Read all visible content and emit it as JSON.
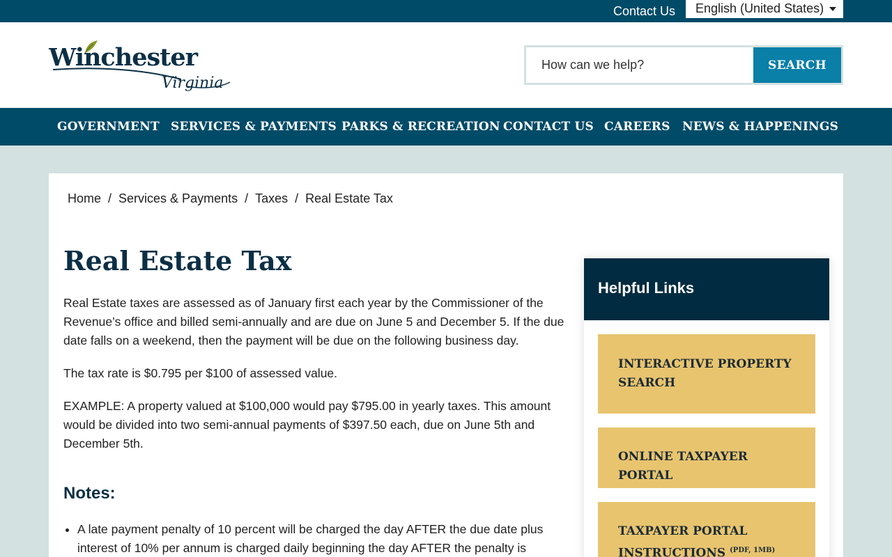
{
  "utility": {
    "contact_label": "Contact Us",
    "language": "English (United States)"
  },
  "logo": {
    "name": "Winchester",
    "script": "Virginia"
  },
  "search": {
    "placeholder": "How can we help?",
    "button_label": "SEARCH"
  },
  "nav": {
    "items": [
      {
        "label": "GOVERNMENT"
      },
      {
        "label": "SERVICES & PAYMENTS"
      },
      {
        "label": "PARKS & RECREATION"
      },
      {
        "label": "CONTACT US"
      },
      {
        "label": "CAREERS"
      },
      {
        "label": "NEWS & HAPPENINGS"
      }
    ]
  },
  "breadcrumb": {
    "items": [
      "Home",
      "Services & Payments",
      "Taxes",
      "Real Estate Tax"
    ],
    "separator": "/"
  },
  "page": {
    "title": "Real Estate Tax",
    "paragraphs": [
      "Real Estate taxes are assessed as of January first each year by the Commissioner of the Revenue’s office and billed semi-annually and are due on June 5 and December 5. If the due date falls on a weekend, then the payment will be due on the following business day.",
      "The tax rate is $0.795 per $100 of assessed value.",
      "EXAMPLE: A property valued at $100,000 would pay $795.00 in yearly taxes. This amount would be divided into two semi-annual payments of $397.50 each, due on June 5th and December 5th."
    ],
    "notes_heading": "Notes:",
    "notes": [
      "A late payment penalty of 10 percent will be charged the day AFTER the due date plus interest of 10% per annum is charged daily beginning the day AFTER the penalty is"
    ]
  },
  "helpful_links": {
    "heading": "Helpful Links",
    "links": [
      {
        "label": "INTERACTIVE PROPERTY SEARCH"
      },
      {
        "label": "ONLINE TAXPAYER PORTAL"
      },
      {
        "label": "TAXPAYER PORTAL INSTRUCTIONS",
        "note": "(PDF, 1MB)"
      }
    ]
  },
  "colors": {
    "primary_dark": "#004b68",
    "navy": "#002b40",
    "search_button": "#0a7fa8",
    "link_card": "#e8c46f",
    "page_bg": "#d3e1e1",
    "logo_leaf": "#8a9a2a"
  }
}
